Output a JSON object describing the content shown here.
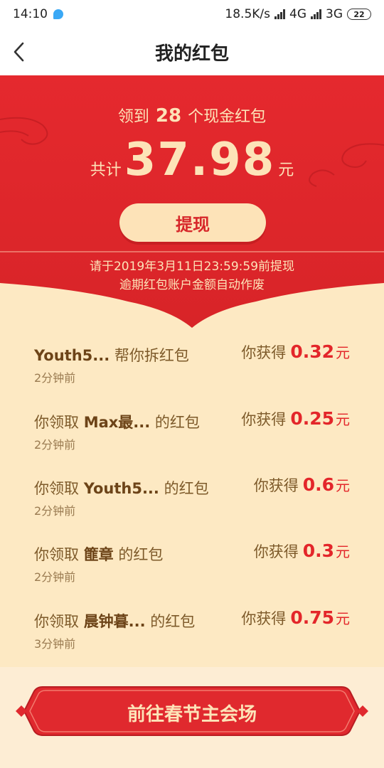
{
  "status_bar": {
    "time": "14:10",
    "speed": "18.5K/s",
    "net1": "4G",
    "net2": "3G",
    "battery": "22"
  },
  "nav": {
    "title": "我的红包"
  },
  "summary": {
    "count_prefix": "领到",
    "count": "28",
    "count_suffix": "个现金红包",
    "total_label": "共计",
    "total_amount": "37.98",
    "total_unit": "元",
    "withdraw_label": "提现",
    "deadline_line1": "请于2019年3月11日23:59:59前提现",
    "deadline_line2": "逾期红包账户金额自动作废"
  },
  "records": [
    {
      "prefix": "",
      "name": "Youth5...",
      "suffix": " 帮你拆红包",
      "time": "2分钟前",
      "gain_label": "你获得",
      "amount": "0.32",
      "unit": "元"
    },
    {
      "prefix": "你领取 ",
      "name": "Max最...",
      "suffix": " 的红包",
      "time": "2分钟前",
      "gain_label": "你获得",
      "amount": "0.25",
      "unit": "元"
    },
    {
      "prefix": "你领取 ",
      "name": "Youth5...",
      "suffix": " 的红包",
      "time": "2分钟前",
      "gain_label": "你获得",
      "amount": "0.6",
      "unit": "元"
    },
    {
      "prefix": "你领取 ",
      "name": "篚章",
      "suffix": " 的红包",
      "time": "2分钟前",
      "gain_label": "你获得",
      "amount": "0.3",
      "unit": "元"
    },
    {
      "prefix": "你领取 ",
      "name": "晨钟暮...",
      "suffix": " 的红包",
      "time": "3分钟前",
      "gain_label": "你获得",
      "amount": "0.75",
      "unit": "元"
    }
  ],
  "bottom": {
    "button_label": "前往春节主会场"
  },
  "colors": {
    "header_red": "#e0292e",
    "gold_text": "#fde3b8",
    "list_bg": "#fde9c3",
    "amount_red": "#e3262a"
  }
}
